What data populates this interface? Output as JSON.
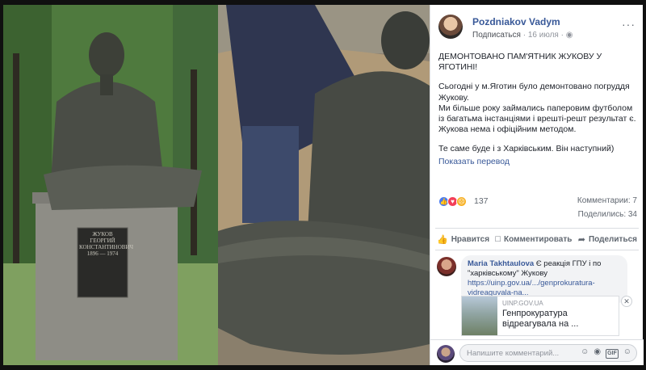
{
  "post": {
    "author": "Pozdniakov Vadym",
    "follow_label": "Подписаться",
    "dot": "·",
    "date": "16 июля",
    "date_sep": "·",
    "paragraphs": [
      "ДЕМОНТОВАНО ПАМ'ЯТНИК ЖУКОВУ У ЯГОТИНІ!",
      "Сьогодні у м.Яготин було демонтовано погруддя Жукову.\nМи більше року займались паперовим футболом із багатьма інстанціями і врешті-решт результат є. Жукова нема і офіційним методом.",
      "Те саме буде і з Харківським. Він наступний)"
    ],
    "translate_label": "Показать перевод"
  },
  "reactions": {
    "count": "137",
    "comments": "Комментарии: 7",
    "shares": "Поделились: 34"
  },
  "actions": {
    "like": "Нравится",
    "comment": "Комментировать",
    "share": "Поделиться"
  },
  "comment": {
    "author": "Maria Takhtaulova",
    "text_before_link": " Є реакція ГПУ і по \"харківському\" Жукову ",
    "link": "https://uinp.gov.ua/.../genprokuratura-vidreaguvala-na...",
    "card_domain": "UINP.GOV.UA",
    "card_title": "Генпрокуратура відреагувала на ..."
  },
  "composer": {
    "placeholder": "Напишите комментарий..."
  },
  "photo": {
    "plaque_line1": "ЖУКОВ",
    "plaque_line2": "ГЕОРГИЙ",
    "plaque_line3": "КОНСТАНТИНОВИЧ",
    "plaque_line4": "1896 — 1974"
  },
  "colors": {
    "link": "#385898",
    "muted": "#606770"
  }
}
